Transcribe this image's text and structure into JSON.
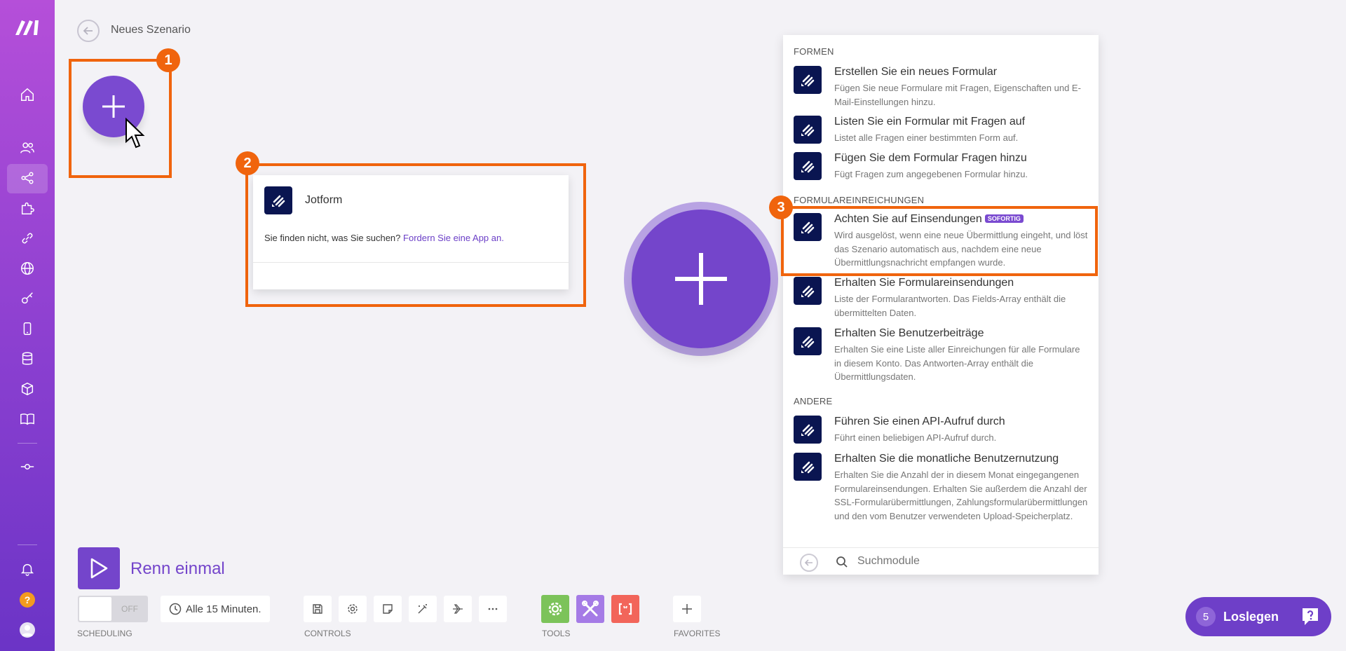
{
  "header": {
    "title": "Neues Szenario"
  },
  "annotations": [
    "1",
    "2",
    "3"
  ],
  "app_search": {
    "app_name": "Jotform",
    "not_found_text": "Sie finden nicht, was Sie suchen?",
    "request_link": "Fordern Sie eine App an."
  },
  "modules": {
    "sections": [
      {
        "title": "FORMEN",
        "items": [
          {
            "title": "Erstellen Sie ein neues Formular",
            "desc": "Fügen Sie neue Formulare mit Fragen, Eigenschaften und E-Mail-Einstellungen hinzu."
          },
          {
            "title": "Listen Sie ein Formular mit Fragen auf",
            "desc": "Listet alle Fragen einer bestimmten Form auf."
          },
          {
            "title": "Fügen Sie dem Formular Fragen hinzu",
            "desc": "Fügt Fragen zum angegebenen Formular hinzu."
          }
        ]
      },
      {
        "title": "FORMULAREINREICHUNGEN",
        "items": [
          {
            "title": "Achten Sie auf Einsendungen",
            "badge": "SOFORTIG",
            "desc": "Wird ausgelöst, wenn eine neue Übermittlung eingeht, und löst das Szenario automatisch aus, nachdem eine neue Übermittlungsnachricht empfangen wurde."
          },
          {
            "title": "Erhalten Sie Formulareinsendungen",
            "desc": "Liste der Formularantworten. Das Fields-Array enthält die übermittelten Daten."
          },
          {
            "title": "Erhalten Sie Benutzerbeiträge",
            "desc": "Erhalten Sie eine Liste aller Einreichungen für alle Formulare in diesem Konto. Das Antworten-Array enthält die Übermittlungsdaten."
          }
        ]
      },
      {
        "title": "ANDERE",
        "items": [
          {
            "title": "Führen Sie einen API-Aufruf durch",
            "desc": "Führt einen beliebigen API-Aufruf durch."
          },
          {
            "title": "Erhalten Sie die monatliche Benutzernutzung",
            "desc": "Erhalten Sie die Anzahl der in diesem Monat eingegangenen Formulareinsendungen. Erhalten Sie außerdem die Anzahl der SSL-Formularübermittlungen, Zahlungsformularübermittlungen und den vom Benutzer verwendeten Upload-Speicherplatz."
          }
        ]
      }
    ],
    "search_placeholder": "Suchmodule"
  },
  "toolbar": {
    "run_label": "Renn einmal",
    "toggle_state": "OFF",
    "schedule_text": "Alle 15 Minuten.",
    "scheduling_label": "SCHEDULING",
    "controls_label": "CONTROLS",
    "tools_label": "TOOLS",
    "favorites_label": "FAVORITES"
  },
  "get_started": {
    "count": "5",
    "label": "Loslegen"
  },
  "colors": {
    "brand": "#7445cb",
    "highlight": "#f0640d",
    "jotform": "#0a1551",
    "tool_green": "#7cc35a",
    "tool_purple": "#a57be6",
    "tool_red": "#f2655a"
  }
}
